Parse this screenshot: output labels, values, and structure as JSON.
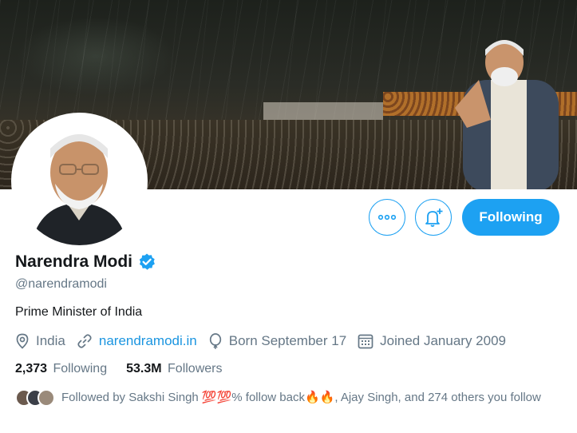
{
  "profile": {
    "name": "Narendra Modi",
    "handle": "@narendramodi",
    "bio": "Prime Minister of India",
    "location": "India",
    "website": "narendramodi.in",
    "birthday": "Born September 17",
    "joined": "Joined January 2009",
    "verified": true
  },
  "stats": {
    "following_count": "2,373",
    "following_label": "Following",
    "followers_count": "53.3M",
    "followers_label": "Followers"
  },
  "followed_by": {
    "text": "Followed by Sakshi Singh 💯💯% follow back🔥🔥, Ajay Singh, and 274 others you follow"
  },
  "actions": {
    "following_button": "Following"
  },
  "colors": {
    "accent": "#1da1f2",
    "link": "#1b95e0",
    "secondary_text": "#657786",
    "primary_text": "#14171a"
  },
  "icons": [
    "more-icon",
    "notification-bell-plus-icon",
    "verified-badge-icon",
    "location-pin-icon",
    "link-icon",
    "balloon-icon",
    "calendar-icon"
  ]
}
